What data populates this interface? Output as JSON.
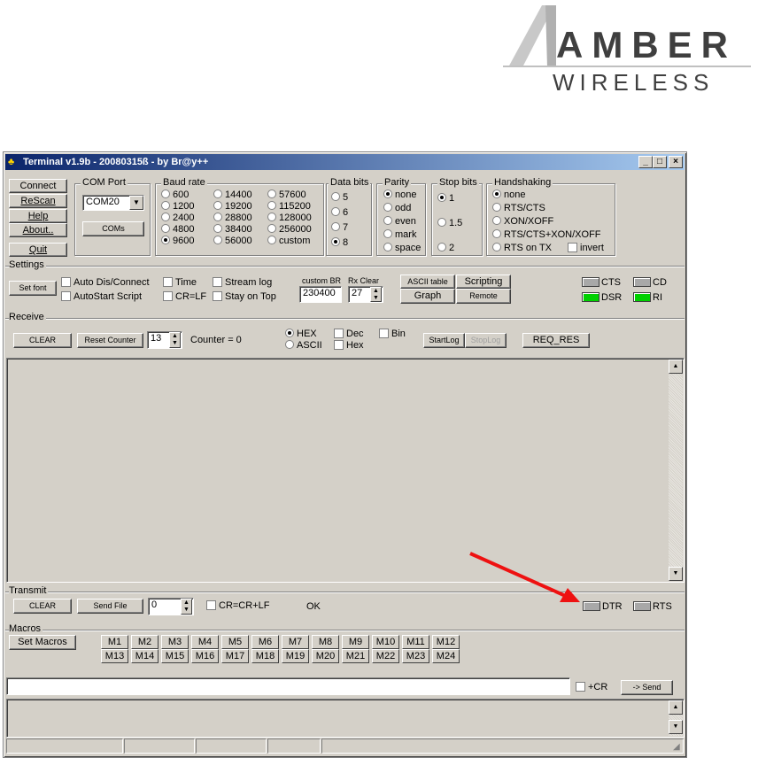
{
  "logo": {
    "line1": "AMBER",
    "line2": "WIRELESS"
  },
  "window": {
    "title": "Terminal v1.9b - 20080315ß - by Br@y++",
    "min_btn": "_",
    "max_btn": "□",
    "close_btn": "×"
  },
  "actions": {
    "connect": "Connect",
    "rescan": "ReScan",
    "help": "Help",
    "about": "About..",
    "quit": "Quit"
  },
  "com_port": {
    "label": "COM Port",
    "value": "COM20",
    "coms_button": "COMs"
  },
  "baud_rate": {
    "label": "Baud rate",
    "options": [
      "600",
      "1200",
      "2400",
      "4800",
      "9600",
      "14400",
      "19200",
      "28800",
      "38400",
      "56000",
      "57600",
      "115200",
      "128000",
      "256000",
      "custom"
    ],
    "selected": "9600"
  },
  "data_bits": {
    "label": "Data bits",
    "options": [
      "5",
      "6",
      "7",
      "8"
    ],
    "selected": "8"
  },
  "parity": {
    "label": "Parity",
    "options": [
      "none",
      "odd",
      "even",
      "mark",
      "space"
    ],
    "selected": "none"
  },
  "stop_bits": {
    "label": "Stop bits",
    "options": [
      "1",
      "1.5",
      "2"
    ],
    "selected": "1"
  },
  "handshaking": {
    "label": "Handshaking",
    "options": [
      "none",
      "RTS/CTS",
      "XON/XOFF",
      "RTS/CTS+XON/XOFF",
      "RTS on TX"
    ],
    "selected": "none",
    "invert_label": "invert"
  },
  "settings": {
    "label": "Settings",
    "set_font": "Set font",
    "auto_dis_connect": "Auto Dis/Connect",
    "autostart_script": "AutoStart Script",
    "time": "Time",
    "cr_lf": "CR=LF",
    "stream_log": "Stream log",
    "stay_on_top": "Stay on Top",
    "custom_br_label": "custom BR",
    "custom_br_value": "230400",
    "rx_clear_label": "Rx Clear",
    "rx_clear_value": "27",
    "ascii_table": "ASCII table",
    "graph": "Graph",
    "scripting": "Scripting",
    "remote": "Remote",
    "leds": {
      "cts": "CTS",
      "cd": "CD",
      "dsr": "DSR",
      "ri": "RI"
    }
  },
  "receive": {
    "label": "Receive",
    "clear": "CLEAR",
    "reset_counter": "Reset Counter",
    "counter_spin": "13",
    "counter_text": "Counter = 0",
    "hex": "HEX",
    "ascii": "ASCII",
    "dec": "Dec",
    "hex_check": "Hex",
    "bin": "Bin",
    "start_log": "StartLog",
    "stop_log": "StopLog",
    "req_res": "REQ_RES"
  },
  "transmit": {
    "label": "Transmit",
    "clear": "CLEAR",
    "send_file": "Send File",
    "spin_value": "0",
    "cr_crlf": "CR=CR+LF",
    "status": "OK",
    "dtr": "DTR",
    "rts": "RTS"
  },
  "macros": {
    "label": "Macros",
    "set_macros": "Set Macros",
    "items": [
      "M1",
      "M2",
      "M3",
      "M4",
      "M5",
      "M6",
      "M7",
      "M8",
      "M9",
      "M10",
      "M11",
      "M12",
      "M13",
      "M14",
      "M15",
      "M16",
      "M17",
      "M18",
      "M19",
      "M20",
      "M21",
      "M22",
      "M23",
      "M24"
    ]
  },
  "send": {
    "input_value": "",
    "plus_cr": "+CR",
    "send_button": "-> Send"
  },
  "colors": {
    "led_green": "#00d000",
    "led_gray": "#a8a8a8",
    "arrow": "#ee1111",
    "title_start": "#0a246a",
    "title_end": "#a6caf0"
  }
}
